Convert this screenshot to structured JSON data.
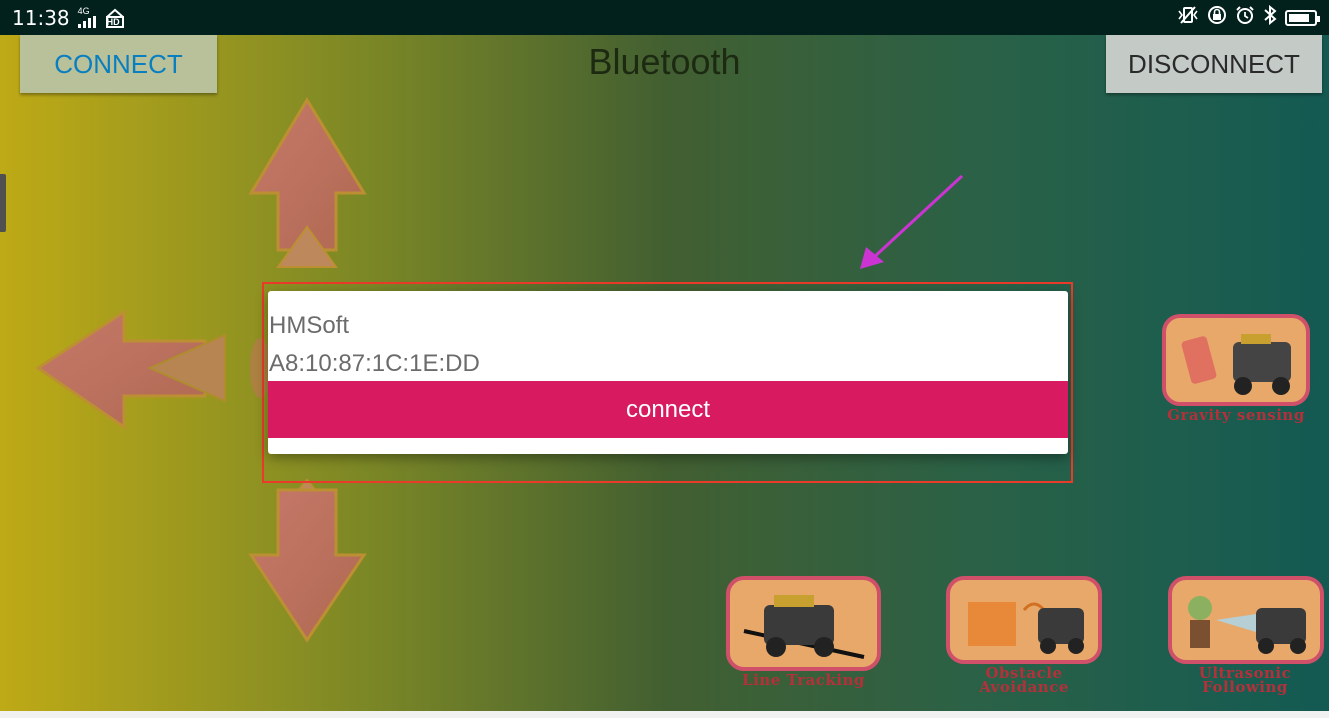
{
  "status_bar": {
    "time": "11:38",
    "network": "4G",
    "hd": "HD",
    "icons": [
      "signal-icon",
      "hd-icon",
      "vibrate-icon",
      "lock-rotation-icon",
      "alarm-icon",
      "bluetooth-icon",
      "battery-icon"
    ],
    "battery_level": 0.85
  },
  "app": {
    "title": "Bluetooth",
    "connect_label": "CONNECT",
    "disconnect_label": "DISCONNECT",
    "features": [
      {
        "id": "gravity",
        "label": "Gravity sensing"
      },
      {
        "id": "line",
        "label": "Line Tracking"
      },
      {
        "id": "obstacle",
        "label": "Obstacle Avoidance"
      },
      {
        "id": "ultrasonic",
        "label": "Ultrasonic Following"
      }
    ]
  },
  "dialog": {
    "device_name": "HMSoft",
    "device_address": "A8:10:87:1C:1E:DD",
    "connect_label": "connect"
  },
  "colors": {
    "accent": "#d81b60",
    "highlight_outline": "#ea3b2a",
    "annotation_arrow": "#e83cf0"
  }
}
